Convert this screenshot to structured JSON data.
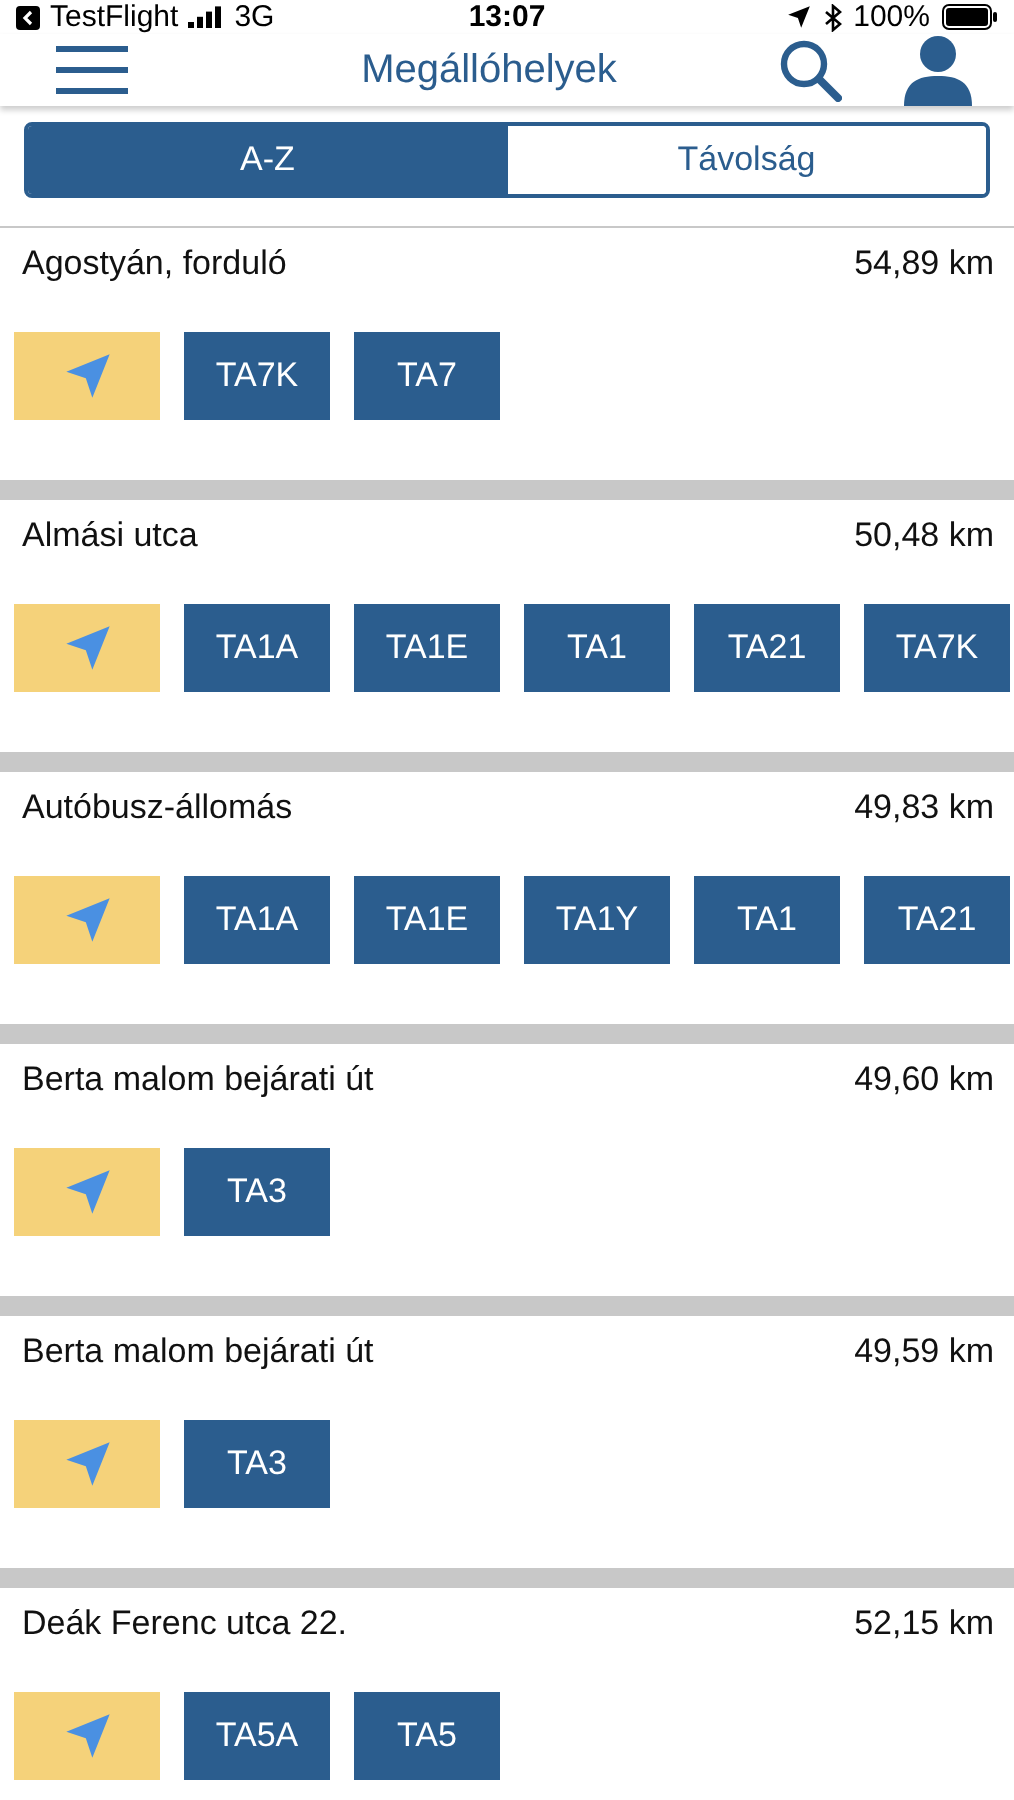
{
  "status_bar": {
    "back_app": "TestFlight",
    "network": "3G",
    "time": "13:07",
    "battery": "100%"
  },
  "header": {
    "title": "Megállóhelyek"
  },
  "segments": [
    {
      "label": "A-Z",
      "selected": true
    },
    {
      "label": "Távolság",
      "selected": false
    }
  ],
  "stops": [
    {
      "name": "Agostyán, forduló",
      "distance": "54,89 km",
      "routes": [
        "TA7K",
        "TA7"
      ]
    },
    {
      "name": "Almási utca",
      "distance": "50,48 km",
      "routes": [
        "TA1A",
        "TA1E",
        "TA1",
        "TA21",
        "TA7K"
      ]
    },
    {
      "name": "Autóbusz-állomás",
      "distance": "49,83 km",
      "routes": [
        "TA1A",
        "TA1E",
        "TA1Y",
        "TA1",
        "TA21"
      ]
    },
    {
      "name": "Berta malom bejárati út",
      "distance": "49,60 km",
      "routes": [
        "TA3"
      ]
    },
    {
      "name": "Berta malom bejárati út",
      "distance": "49,59 km",
      "routes": [
        "TA3"
      ]
    },
    {
      "name": "Deák Ferenc utca 22.",
      "distance": "52,15 km",
      "routes": [
        "TA5A",
        "TA5"
      ]
    }
  ]
}
